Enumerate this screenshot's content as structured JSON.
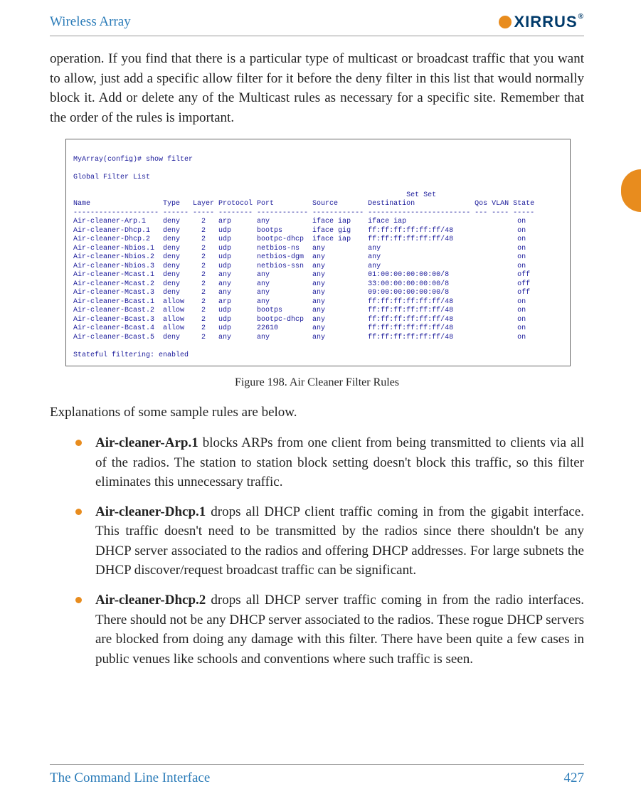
{
  "header": {
    "title": "Wireless Array",
    "brand_text": "XIRRUS",
    "brand_symbol": "®"
  },
  "intro_para": "operation. If you find that there is a particular type of multicast or broadcast traffic that you want to allow, just add a specific allow filter for it before the deny filter in this list that would normally block it. Add or delete any of the Multicast rules as necessary for a specific site. Remember that the order of the rules is important.",
  "terminal": {
    "prompt": "MyArray(config)# show filter",
    "list_title": "Global Filter List",
    "header_top": "                                                                              Set Set",
    "header_cols": "Name                 Type   Layer Protocol Port         Source       Destination              Qos VLAN State",
    "header_sep": "-------------------- ------ ----- -------- ------------ ------------ ------------------------ --- ---- -----",
    "rows": [
      "Air-cleaner-Arp.1    deny     2   arp      any          iface iap    iface iap                          on",
      "Air-cleaner-Dhcp.1   deny     2   udp      bootps       iface gig    ff:ff:ff:ff:ff:ff/48               on",
      "Air-cleaner-Dhcp.2   deny     2   udp      bootpc-dhcp  iface iap    ff:ff:ff:ff:ff:ff/48               on",
      "Air-cleaner-Nbios.1  deny     2   udp      netbios-ns   any          any                                on",
      "Air-cleaner-Nbios.2  deny     2   udp      netbios-dgm  any          any                                on",
      "Air-cleaner-Nbios.3  deny     2   udp      netbios-ssn  any          any                                on",
      "Air-cleaner-Mcast.1  deny     2   any      any          any          01:00:00:00:00:00/8                off",
      "Air-cleaner-Mcast.2  deny     2   any      any          any          33:00:00:00:00:00/8                off",
      "Air-cleaner-Mcast.3  deny     2   any      any          any          09:00:00:00:00:00/8                off",
      "Air-cleaner-Bcast.1  allow    2   arp      any          any          ff:ff:ff:ff:ff:ff/48               on",
      "Air-cleaner-Bcast.2  allow    2   udp      bootps       any          ff:ff:ff:ff:ff:ff/48               on",
      "Air-cleaner-Bcast.3  allow    2   udp      bootpc-dhcp  any          ff:ff:ff:ff:ff:ff/48               on",
      "Air-cleaner-Bcast.4  allow    2   udp      22610        any          ff:ff:ff:ff:ff:ff/48               on",
      "Air-cleaner-Bcast.5  deny     2   any      any          any          ff:ff:ff:ff:ff:ff/48               on"
    ],
    "footer_line": "Stateful filtering: enabled"
  },
  "figure_caption": "Figure 198. Air Cleaner Filter Rules",
  "explain_intro": "Explanations of some sample rules are below.",
  "bullets": [
    {
      "bold": "Air-cleaner-Arp.1",
      "rest": " blocks ARPs from one client from being transmitted to clients via all of the radios. The station to station block setting doesn't block this traffic, so this filter eliminates this unnecessary traffic."
    },
    {
      "bold": "Air-cleaner-Dhcp.1",
      "rest": " drops all DHCP client traffic coming in from the gigabit interface. This traffic doesn't need to be transmitted by the radios since there shouldn't be any DHCP server associated to the radios and offering DHCP addresses. For large subnets the DHCP discover/request broadcast traffic can be significant."
    },
    {
      "bold": "Air-cleaner-Dhcp.2",
      "rest": " drops all DHCP server traffic coming in from the radio interfaces. There should not be any DHCP server associated to the radios. These rogue DHCP servers are blocked from doing any damage with this filter. There have been quite a few cases in public venues like schools and conventions where such traffic is seen."
    }
  ],
  "footer": {
    "section": "The Command Line Interface",
    "page": "427"
  }
}
